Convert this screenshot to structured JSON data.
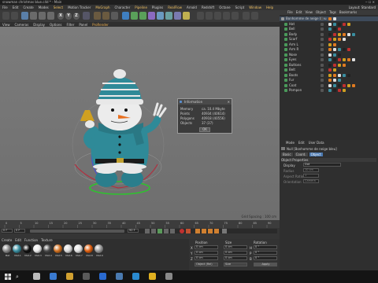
{
  "window": {
    "title": "snowman christmas blue.c4d * - Main"
  },
  "menu": [
    "File",
    "Edit",
    "Create",
    "Modes",
    "Select",
    "Motion Tracker",
    "MoGraph",
    "Character",
    "Pipeline",
    "Plugins",
    "RealFlow",
    "Arnold",
    "Redshift",
    "Octane",
    "Script",
    "Window",
    "Help"
  ],
  "layout_label": "Layout: Standard",
  "toolbar": {
    "x": "X",
    "y": "Y",
    "z": "Z"
  },
  "viewport": {
    "menu": [
      "View",
      "Cameras",
      "Display",
      "Options",
      "Filter",
      "Panel",
      "ProRender"
    ],
    "active_menu": "ProRender",
    "grid_spacing": "Grid Spacing : 100 cm"
  },
  "info_dialog": {
    "title": "Information",
    "rows": [
      {
        "label": "Memory",
        "value": "ca. 10.4 Mbyte"
      },
      {
        "label": "Points",
        "value": "40934 (40614)"
      },
      {
        "label": "Polygons",
        "value": "40918 (40556)"
      },
      {
        "label": "Objects",
        "value": "37 (37)"
      }
    ],
    "ok_label": "OK"
  },
  "timeline": {
    "ticks": [
      "0",
      "5",
      "10",
      "15",
      "20",
      "25",
      "30",
      "35",
      "40",
      "45",
      "50",
      "55",
      "60",
      "65",
      "70",
      "75",
      "80",
      "85",
      "90"
    ],
    "frame_start": "0 F",
    "frame_end": "90 F",
    "current": "0 F"
  },
  "materials": {
    "menu": [
      "Create",
      "Edit",
      "Function",
      "Texture"
    ],
    "items": [
      {
        "name": "Mat",
        "color": "#8a8a8a"
      },
      {
        "name": "Mat.1",
        "color": "#3a8ea0"
      },
      {
        "name": "Mat.2",
        "color": "#111111"
      },
      {
        "name": "Mat.3",
        "color": "#e8e8e8"
      },
      {
        "name": "Mat.4",
        "color": "#4a4a4a"
      },
      {
        "name": "Mat.5",
        "color": "#d07020"
      },
      {
        "name": "Mat.6",
        "color": "#d8d8d8"
      },
      {
        "name": "Mat.7",
        "color": "#e0e0e0"
      },
      {
        "name": "Mat.8",
        "color": "#e06010"
      },
      {
        "name": "Mat.9",
        "color": "#9a9a9a"
      }
    ]
  },
  "coords": {
    "headers": [
      "Position",
      "Size",
      "Rotation"
    ],
    "rows": [
      {
        "axis": "X",
        "pos": "0 cm",
        "size": "0 cm",
        "rot_axis": "H",
        "rot": "0 °"
      },
      {
        "axis": "Y",
        "pos": "0 cm",
        "size": "0 cm",
        "rot_axis": "P",
        "rot": "0 °"
      },
      {
        "axis": "Z",
        "pos": "0 cm",
        "size": "0 cm",
        "rot_axis": "B",
        "rot": "0 °"
      }
    ],
    "mode": "Object (Rel)",
    "size_mode": "Size",
    "apply": "Apply"
  },
  "objects": {
    "tabs": [
      "File",
      "Edit",
      "View",
      "Object",
      "Tags",
      "Bookmarks"
    ],
    "items": [
      {
        "name": "Bonhomme de neige bleu",
        "level": 0
      },
      {
        "name": "Hat",
        "level": 1
      },
      {
        "name": "Bell",
        "level": 1
      },
      {
        "name": "Body",
        "level": 1
      },
      {
        "name": "Scarf",
        "level": 1
      },
      {
        "name": "Arm L",
        "level": 1
      },
      {
        "name": "Arm R",
        "level": 1
      },
      {
        "name": "Nose",
        "level": 1
      },
      {
        "name": "Eyes",
        "level": 1
      },
      {
        "name": "Buttons",
        "level": 1
      },
      {
        "name": "Belt",
        "level": 1
      },
      {
        "name": "Boots",
        "level": 1
      },
      {
        "name": "Fur",
        "level": 1
      },
      {
        "name": "Coat",
        "level": 1
      },
      {
        "name": "Pompon",
        "level": 1
      }
    ]
  },
  "attributes": {
    "tabs": [
      "Mode",
      "Edit",
      "User Data"
    ],
    "object_label": "Null [Bonhomme de neige bleu]",
    "subtabs": [
      "Basic",
      "Coord.",
      "Object"
    ],
    "active_subtab": "Object",
    "section": "Object Properties",
    "props": [
      {
        "label": "Display",
        "value": "Dot"
      },
      {
        "label": "Radius",
        "value": "10 cm"
      },
      {
        "label": "Aspect Ratio",
        "value": "1"
      },
      {
        "label": "Orientation",
        "value": "Camera"
      }
    ]
  },
  "taskbar": {
    "search_icon": "search-icon",
    "apps": [
      "task-view-icon",
      "edge-icon",
      "folder-icon",
      "store-icon",
      "mail-icon",
      "cinema4d-icon",
      "photoshop-icon",
      "chrome-icon",
      "app-icon"
    ]
  },
  "colors": {
    "accent": "#f0b050",
    "teal": "#2f8a98",
    "dialog_border": "#9a9a9a"
  }
}
